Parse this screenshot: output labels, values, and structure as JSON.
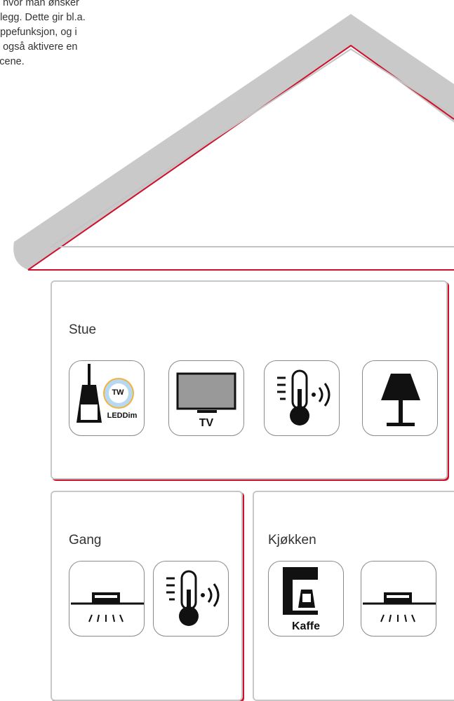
{
  "intro": {
    "text": "o hvor man ønsker\nolegg. Dette gir bl.a.\nappefunksjon, og i\nn også aktivere en\nscene."
  },
  "rooms": [
    {
      "title": "Stue",
      "devices": [
        {
          "name": "pendant-ledDim-tw",
          "badge": "TW",
          "label": "LEDDim"
        },
        {
          "name": "tv",
          "label": "TV"
        },
        {
          "name": "thermostat"
        },
        {
          "name": "table-lamp"
        }
      ]
    },
    {
      "title": "Gang",
      "devices": [
        {
          "name": "ceiling-light"
        },
        {
          "name": "thermostat"
        }
      ]
    },
    {
      "title": "Kjøkken",
      "devices": [
        {
          "name": "coffee-maker",
          "label": "Kaffe"
        },
        {
          "name": "ceiling-light"
        }
      ]
    }
  ],
  "colors": {
    "roof_gray": "#c9c9c9",
    "accent_red": "#d0102a",
    "border_gray": "#c7c7c7"
  }
}
